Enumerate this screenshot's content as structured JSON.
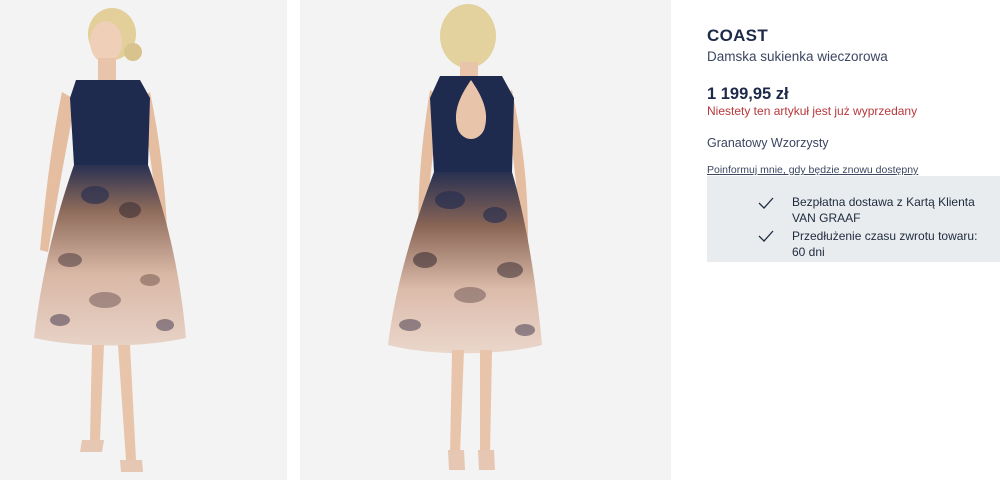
{
  "product": {
    "brand": "COAST",
    "subtitle": "Damska sukienka wieczorowa",
    "price": "1 199,95 zł",
    "sold_out_text": "Niestety ten artykuł jest już wyprzedany",
    "color": "Granatowy Wzorzysty",
    "notify_link": "Poinformuj mnie, gdy będzie znowu dostępny"
  },
  "benefits": [
    {
      "icon": "check-icon",
      "text": "Bezpłatna dostawa z Kartą Klienta VAN GRAAF"
    },
    {
      "icon": "check-icon",
      "text": "Przedłużenie czasu zwrotu towaru: 60 dni"
    }
  ],
  "colors": {
    "brand_text": "#1e2a4a",
    "sold_out": "#b8383b",
    "benefits_bg": "#e8ecef",
    "photo_bg": "#f3f3f3",
    "dress_navy": "#1f2a4f"
  }
}
